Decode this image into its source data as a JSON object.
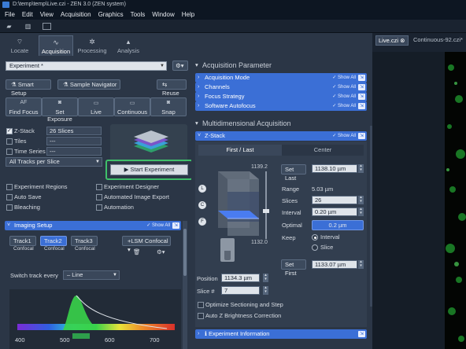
{
  "window": {
    "title": "D:\\temp\\temp\\Live.czi - ZEN 3.0 (ZEN system)"
  },
  "menu": [
    "File",
    "Edit",
    "View",
    "Acquisition",
    "Graphics",
    "Tools",
    "Window",
    "Help"
  ],
  "left_tabs": [
    {
      "label": "Locate",
      "icon": "locate-icon"
    },
    {
      "label": "Acquisition",
      "icon": "acquisition-icon",
      "active": true
    },
    {
      "label": "Processing",
      "icon": "processing-icon"
    },
    {
      "label": "Analysis",
      "icon": "analysis-icon"
    }
  ],
  "experiment": {
    "selected": "Experiment *"
  },
  "smart_setup": "Smart Setup",
  "sample_navigator": "Sample Navigator",
  "reuse": "Reuse",
  "actions": [
    {
      "label": "Find Focus",
      "icon": "AF"
    },
    {
      "label": "Set Exposure",
      "icon": "camera-icon"
    },
    {
      "label": "Live",
      "icon": "live-icon"
    },
    {
      "label": "Continuous",
      "icon": "continuous-icon"
    },
    {
      "label": "Snap",
      "icon": "snap-icon"
    }
  ],
  "dimensions": {
    "zstack": {
      "label": "Z-Stack",
      "value": "26 Slices",
      "checked": true
    },
    "tiles": {
      "label": "Tiles",
      "value": "---",
      "checked": false
    },
    "time_series": {
      "label": "Time Series",
      "value": "---",
      "checked": false
    }
  },
  "tracks_mode": "All Tracks per Slice",
  "start_experiment": "Start Experiment",
  "options": {
    "experiment_regions": "Experiment Regions",
    "experiment_designer": "Experiment Designer",
    "auto_save": "Auto Save",
    "automated_image_export": "Automated Image Export",
    "bleaching": "Bleaching",
    "automation": "Automation"
  },
  "imaging_setup": {
    "title": "Imaging Setup",
    "show_all": "Show All",
    "tracks": [
      {
        "name": "Track1",
        "sub": "Confocal"
      },
      {
        "name": "Track2",
        "sub": "Confocal",
        "active": true
      },
      {
        "name": "Track3",
        "sub": "Confocal"
      }
    ],
    "add_button": "+LSM Confocal",
    "switch_label": "Switch track every",
    "switch_value": "Line",
    "spectrum_ticks": [
      "400",
      "500",
      "600",
      "700"
    ]
  },
  "acq_params": {
    "header": "Acquisition Parameter",
    "items": [
      {
        "label": "Acquisition Mode",
        "show": "Show All"
      },
      {
        "label": "Channels",
        "show": "Show All"
      },
      {
        "label": "Focus Strategy",
        "show": "Show All"
      },
      {
        "label": "Software Autofocus",
        "show": "Show All"
      }
    ]
  },
  "multidim": {
    "header": "Multidimensional Acquisition",
    "zstack_title": "Z-Stack",
    "show_all": "Show All",
    "tab_first_last": "First / Last",
    "tab_center": "Center",
    "set_last": "Set Last",
    "last_value": "1138.10 µm",
    "range_label": "Range",
    "range_value": "5.03 µm",
    "slices_label": "Slices",
    "slices_value": "26",
    "interval_label": "Interval",
    "interval_value": "0.20 µm",
    "optimal_label": "Optimal",
    "optimal_value": "0.2 µm",
    "keep_label": "Keep",
    "keep_interval": "Interval",
    "keep_slice": "Slice",
    "set_first": "Set First",
    "first_value": "1133.07 µm",
    "scale_top": "1139.2",
    "scale_bottom": "1132.0",
    "position_label": "Position",
    "position_value": "1134.3 µm",
    "slice_label": "Slice #",
    "slice_value": "7",
    "optimize": "Optimize Sectioning and Step",
    "auto_z": "Auto Z Brightness Correction",
    "exp_info": "Experiment Information"
  },
  "doc_tabs": [
    "Live.czi",
    "Continuous-92.czi*"
  ]
}
